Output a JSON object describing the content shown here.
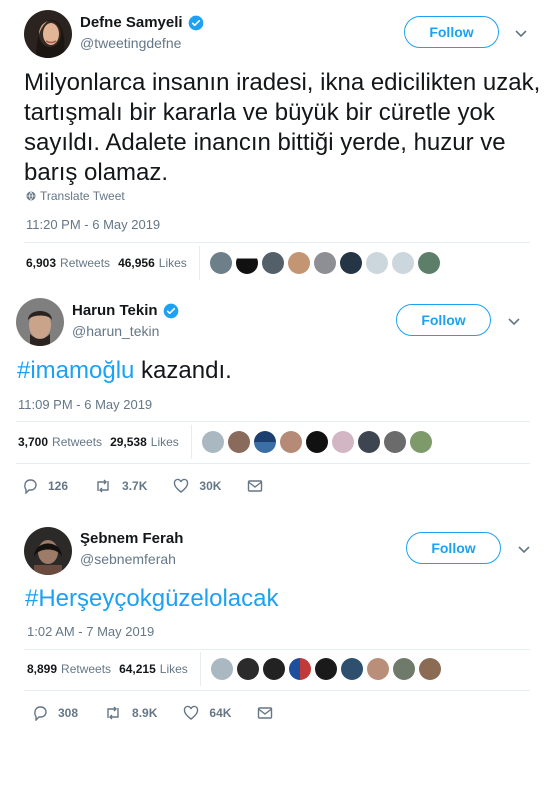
{
  "tweets": [
    {
      "name": "Defne Samyeli",
      "handle": "@tweetingdefne",
      "follow_label": "Follow",
      "text": "Milyonlarca insanın iradesi, ikna edicilikten uzak, tartışmalı bir kararla ve büyük bir cüretle yok sayıldı. Adalete inancın bittiği yerde, huzur ve barış olamaz.",
      "translate_label": "Translate Tweet",
      "timestamp": "11:20 PM - 6 May 2019",
      "retweets_count": "6,903",
      "retweets_label": "Retweets",
      "likes_count": "46,956",
      "likes_label": "Likes"
    },
    {
      "name": "Harun Tekin",
      "handle": "@harun_tekin",
      "follow_label": "Follow",
      "hashtag": "#imamoğlu",
      "text_rest": " kazandı.",
      "timestamp": "11:09 PM - 6 May 2019",
      "retweets_count": "3,700",
      "retweets_label": "Retweets",
      "likes_count": "29,538",
      "likes_label": "Likes",
      "replies": "126",
      "retweets_short": "3.7K",
      "likes_short": "30K"
    },
    {
      "name": "Şebnem Ferah",
      "handle": "@sebnemferah",
      "follow_label": "Follow",
      "hashtag": "#Herşeyçokgüzelolacak",
      "timestamp": "1:02 AM - 7 May 2019",
      "retweets_count": "8,899",
      "retweets_label": "Retweets",
      "likes_count": "64,215",
      "likes_label": "Likes",
      "replies": "308",
      "retweets_short": "8.9K",
      "likes_short": "64K"
    }
  ],
  "colors": {
    "accent": "#1da1f2",
    "text": "#14171a",
    "muted": "#657786",
    "divider": "#e6ecf0"
  }
}
